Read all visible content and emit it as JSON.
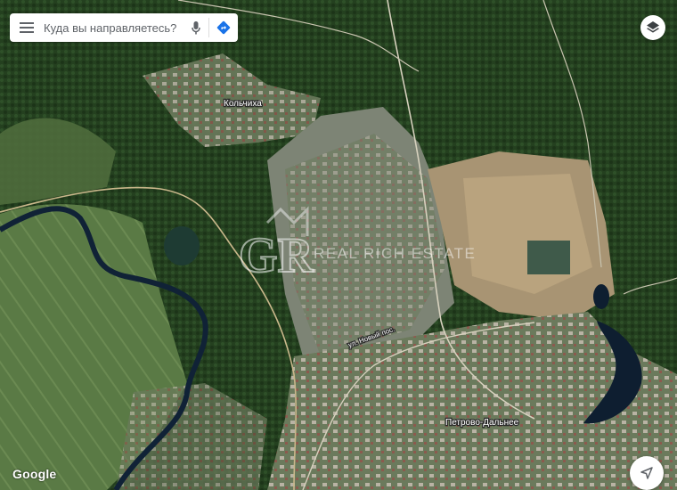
{
  "search": {
    "placeholder": "Куда вы направляетесь?"
  },
  "icons": {
    "menu": "hamburger-menu-icon",
    "mic": "microphone-icon",
    "directions": "directions-icon",
    "layers": "layers-icon",
    "locate": "my-location-icon"
  },
  "map": {
    "type": "satellite",
    "labels": {
      "village_north": "Кольчиха",
      "town": "Петрово-Дальнее",
      "street": "ул. Новый пос."
    },
    "watermark": "REAL RICH ESTATE",
    "attribution": "Google"
  },
  "colors": {
    "directions": "#1a73e8",
    "label_text": "#ffffff"
  }
}
